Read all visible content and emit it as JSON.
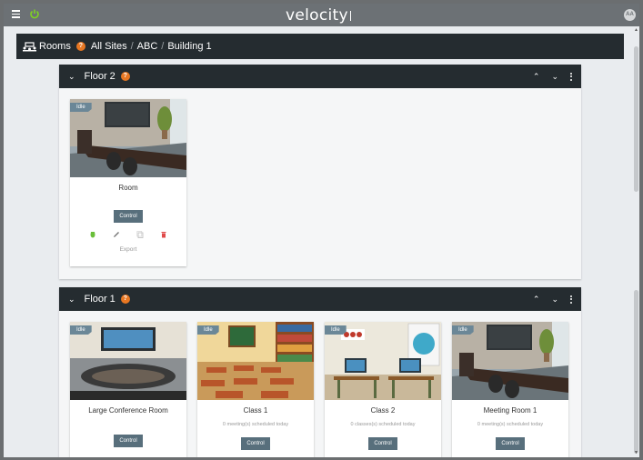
{
  "app": {
    "logo": "velocity",
    "user_initials": "AA"
  },
  "breadcrumb": {
    "title": "Rooms",
    "help": "?",
    "crumbs": [
      "All Sites",
      "ABC",
      "Building 1"
    ]
  },
  "colors": {
    "header_bg": "#252c30",
    "accent": "#e87722",
    "button": "#586f7c",
    "idle_badge": "#6b8797"
  },
  "floors": [
    {
      "name": "Floor 2",
      "rooms": [
        {
          "status": "Idle",
          "name": "Room",
          "control_label": "Control",
          "export_label": "Export"
        }
      ]
    },
    {
      "name": "Floor 1",
      "rooms": [
        {
          "status": "Idle",
          "name": "Large Conference Room",
          "control_label": "Control",
          "subtitle": ""
        },
        {
          "status": "Idle",
          "name": "Class 1",
          "subtitle": "0 meeting(s) scheduled today",
          "control_label": "Control"
        },
        {
          "status": "Idle",
          "name": "Class 2",
          "subtitle": "0 classes(s) scheduled today",
          "control_label": "Control"
        },
        {
          "status": "Idle",
          "name": "Meeting Room 1",
          "subtitle": "0 meeting(s) scheduled today",
          "control_label": "Control"
        }
      ]
    }
  ]
}
